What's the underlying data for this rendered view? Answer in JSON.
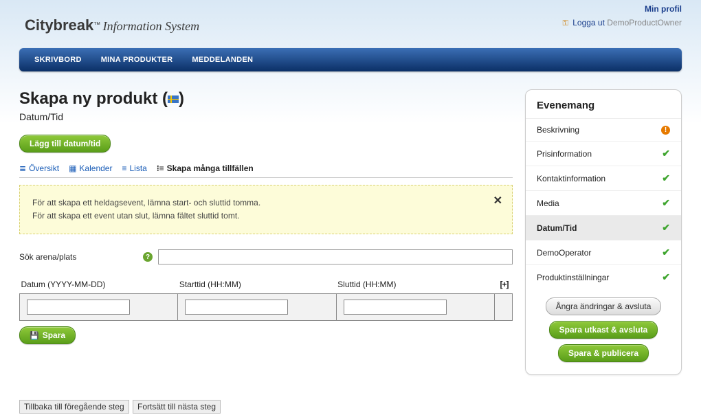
{
  "header": {
    "profile_link": "Min profil",
    "logout_prefix": "Logga ut",
    "user": "DemoProductOwner",
    "logo_main": "Citybreak",
    "logo_tm": "™",
    "logo_tag": "Information System"
  },
  "nav": {
    "items": [
      "SKRIVBORD",
      "MINA PRODUKTER",
      "MEDDELANDEN"
    ]
  },
  "page": {
    "title": "Skapa ny produkt",
    "subtitle": "Datum/Tid",
    "add_button": "Lägg till datum/tid",
    "tabs": [
      {
        "label": "Översikt",
        "icon": "≣"
      },
      {
        "label": "Kalender",
        "icon": "▦"
      },
      {
        "label": "Lista",
        "icon": "≡"
      },
      {
        "label": "Skapa många tillfällen",
        "icon": "⁝≡",
        "active": true
      }
    ],
    "info_line1": "För att skapa ett heldagsevent, lämna start- och sluttid tomma.",
    "info_line2": "För att skapa ett event utan slut, lämna fältet sluttid tomt.",
    "search_label": "Sök arena/plats",
    "table": {
      "col_date": "Datum (YYYY-MM-DD)",
      "col_start": "Starttid (HH:MM)",
      "col_end": "Sluttid (HH:MM)",
      "add_symbol": "[+]"
    },
    "save_button": "Spara",
    "back_link": "Tillbaka till föregående steg",
    "next_link": "Fortsätt till nästa steg"
  },
  "sidebar": {
    "title": "Evenemang",
    "items": [
      {
        "label": "Beskrivning",
        "status": "warn"
      },
      {
        "label": "Prisinformation",
        "status": "ok"
      },
      {
        "label": "Kontaktinformation",
        "status": "ok"
      },
      {
        "label": "Media",
        "status": "ok"
      },
      {
        "label": "Datum/Tid",
        "status": "ok",
        "active": true
      },
      {
        "label": "DemoOperator",
        "status": "ok"
      },
      {
        "label": "Produktinställningar",
        "status": "ok"
      }
    ],
    "btn_cancel": "Ångra ändringar & avsluta",
    "btn_draft": "Spara utkast & avsluta",
    "btn_publish": "Spara & publicera"
  }
}
